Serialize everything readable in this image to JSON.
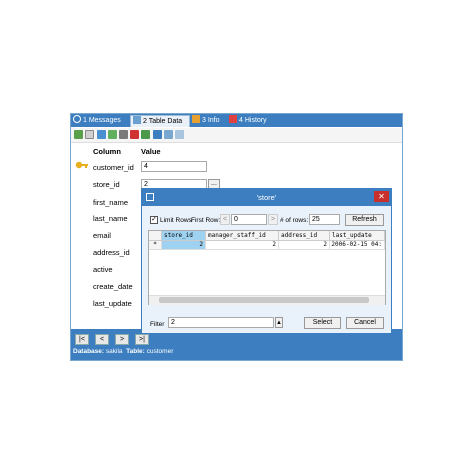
{
  "tabs": [
    {
      "label": "1 Messages",
      "icon": "info-icon"
    },
    {
      "label": "2 Table Data",
      "icon": "grid-icon"
    },
    {
      "label": "3 Info",
      "icon": "info-chart-icon"
    },
    {
      "label": "4 History",
      "icon": "calendar-icon"
    }
  ],
  "form": {
    "column_header": "Column",
    "value_header": "Value",
    "rows": [
      {
        "label": "customer_id",
        "value": "4"
      },
      {
        "label": "store_id",
        "value": "2"
      },
      {
        "label": "first_name"
      },
      {
        "label": "last_name"
      },
      {
        "label": "email"
      },
      {
        "label": "address_id"
      },
      {
        "label": "active"
      },
      {
        "label": "create_date"
      },
      {
        "label": "last_update"
      }
    ],
    "lookup_button": "..."
  },
  "nav": {
    "first": "|<",
    "prev": "<",
    "next": ">",
    "last": ">|"
  },
  "status": {
    "db_label": "Database:",
    "db_value": "sakila",
    "table_label": "Table:",
    "table_value": "customer"
  },
  "dialog": {
    "title": "'store'",
    "close": "✕",
    "limit_rows": "Limit Rows",
    "first_row_label": "First Row:",
    "first_row_value": "0",
    "rows_label": "# of rows:",
    "rows_value": "25",
    "refresh": "Refresh",
    "prev_arrow": "<",
    "next_arrow": ">",
    "columns": [
      "store_id",
      "manager_staff_id",
      "address_id",
      "last_update"
    ],
    "row": {
      "marker": "*",
      "store_id": "2",
      "manager_staff_id": "2",
      "address_id": "2",
      "last_update": "2006-02-15 04:"
    },
    "filter_label": "Filter",
    "filter_value": "2",
    "select": "Select",
    "cancel": "Cancel"
  },
  "colors": {
    "accent": "#3c7ebf",
    "close": "#c9302c",
    "selected": "#9fd2f0"
  }
}
